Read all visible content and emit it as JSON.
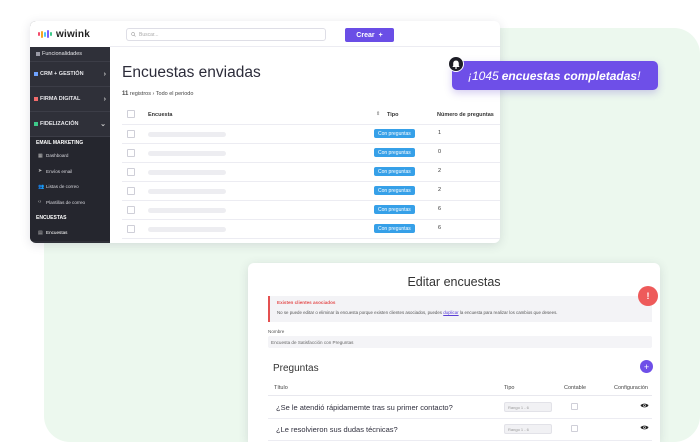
{
  "brand": {
    "name": "wiwink",
    "bar_colors": [
      "#f44a6b",
      "#f5a623",
      "#4fc3f7",
      "#7b61ff",
      "#3ec98a"
    ]
  },
  "sidebar": {
    "items": [
      {
        "label": "Funcionalidades"
      },
      {
        "label": "CRM + GESTIÓN"
      },
      {
        "label": "FIRMA DIGITAL"
      },
      {
        "label": "FIDELIZACIÓN"
      }
    ],
    "sections": [
      {
        "title": "EMAIL MARKETING",
        "links": [
          {
            "label": "Dashboard",
            "icon": "grid-icon"
          },
          {
            "label": "Envíos email",
            "icon": "send-icon"
          },
          {
            "label": "Listas de correo",
            "icon": "users-icon"
          },
          {
            "label": "Plantillas de correo",
            "icon": "code-icon"
          }
        ]
      },
      {
        "title": "ENCUESTAS",
        "links": [
          {
            "label": "Encuestas",
            "icon": "clipboard-icon"
          }
        ]
      }
    ]
  },
  "topbar": {
    "search_placeholder": "Buscar...",
    "create_label": "Crear"
  },
  "surveys_page": {
    "title": "Encuestas enviadas",
    "count": "11",
    "count_label": "registros",
    "period": "› Todo el periodo",
    "columns": [
      "Encuesta",
      "Tipo",
      "Número de preguntas"
    ],
    "rows": [
      {
        "tipo": "Con preguntas",
        "num": "1"
      },
      {
        "tipo": "Con preguntas",
        "num": "0"
      },
      {
        "tipo": "Con preguntas",
        "num": "2"
      },
      {
        "tipo": "Con preguntas",
        "num": "2"
      },
      {
        "tipo": "Con preguntas",
        "num": "6"
      },
      {
        "tipo": "Con preguntas",
        "num": "6"
      }
    ]
  },
  "badge": {
    "number": "¡1045",
    "text": "encuestas completadas",
    "end": "!"
  },
  "edit_page": {
    "title": "Editar encuestas",
    "alert_title": "Existen clientes asociados",
    "alert_message_pre": "No se puede editar o eliminar la encuesta porque existen clientes asociados, puedes",
    "alert_link": "duplicar",
    "alert_message_post": "la encuesta para realizar los cambios que desees.",
    "name_label": "Nombre",
    "name_value": "Encuesta de Satisfacción con Preguntas",
    "questions_title": "Preguntas",
    "question_columns": [
      "Título",
      "Tipo",
      "Contable",
      "Configuración"
    ],
    "questions": [
      {
        "title": "¿Se le atendió rápidamemte tras su primer contacto?",
        "type": "Rango 1 - 6"
      },
      {
        "title": "¿Le resolvieron sus dudas técnicas?",
        "type": "Rango 1 - 6"
      }
    ]
  }
}
